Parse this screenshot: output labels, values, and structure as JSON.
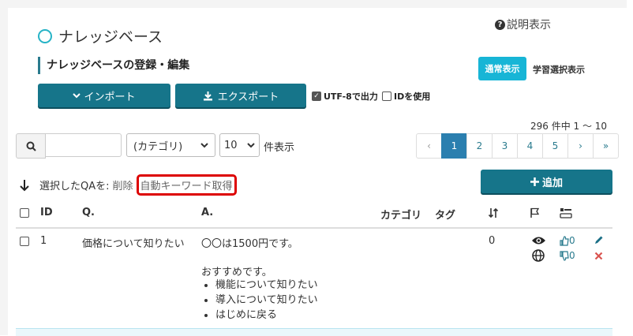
{
  "page": {
    "title": "ナレッジベース",
    "help_link": "説明表示",
    "section_title": "ナレッジベースの登録・編集"
  },
  "view_toggle": {
    "normal": "通常表示",
    "learning": "学習選択表示"
  },
  "toolbar": {
    "import_label": "インポート",
    "export_label": "エクスポート",
    "utf8_label": "UTF-8で出力",
    "utf8_checked": true,
    "use_id_label": "IDを使用",
    "use_id_checked": false
  },
  "result_count": "296 件中 1 ～ 10",
  "filters": {
    "search_value": "",
    "category_selected": "(カテゴリ)",
    "per_page_selected": "10",
    "per_page_suffix": "件表示"
  },
  "pagination": {
    "prev": "‹",
    "pages": [
      "1",
      "2",
      "3",
      "4",
      "5"
    ],
    "current": "1",
    "next": "›",
    "last": "»"
  },
  "bulk_actions": {
    "prefix": "選択したQAを:",
    "delete_label": "削除",
    "auto_keyword_label": "自動キーワード取得"
  },
  "add_button_label": "追加",
  "table": {
    "columns": {
      "id": "ID",
      "question": "Q.",
      "answer": "A.",
      "category": "カテゴリ",
      "tag": "タグ"
    },
    "rows": [
      {
        "id": "1",
        "question": "価格について知りたい",
        "answer_line1": "〇〇は1500円です。",
        "answer_line2": "おすすめです。",
        "answer_items": [
          "機能について知りたい",
          "導入について知りたい",
          "はじめに戻る"
        ],
        "count": "0",
        "likes": "0",
        "dislikes": "0"
      }
    ]
  },
  "colors": {
    "accent": "#16758a",
    "active_page": "#2b7faf",
    "normal_view": "#17b5d6",
    "highlight": "#dd0000",
    "delete_icon": "#d9534f"
  }
}
